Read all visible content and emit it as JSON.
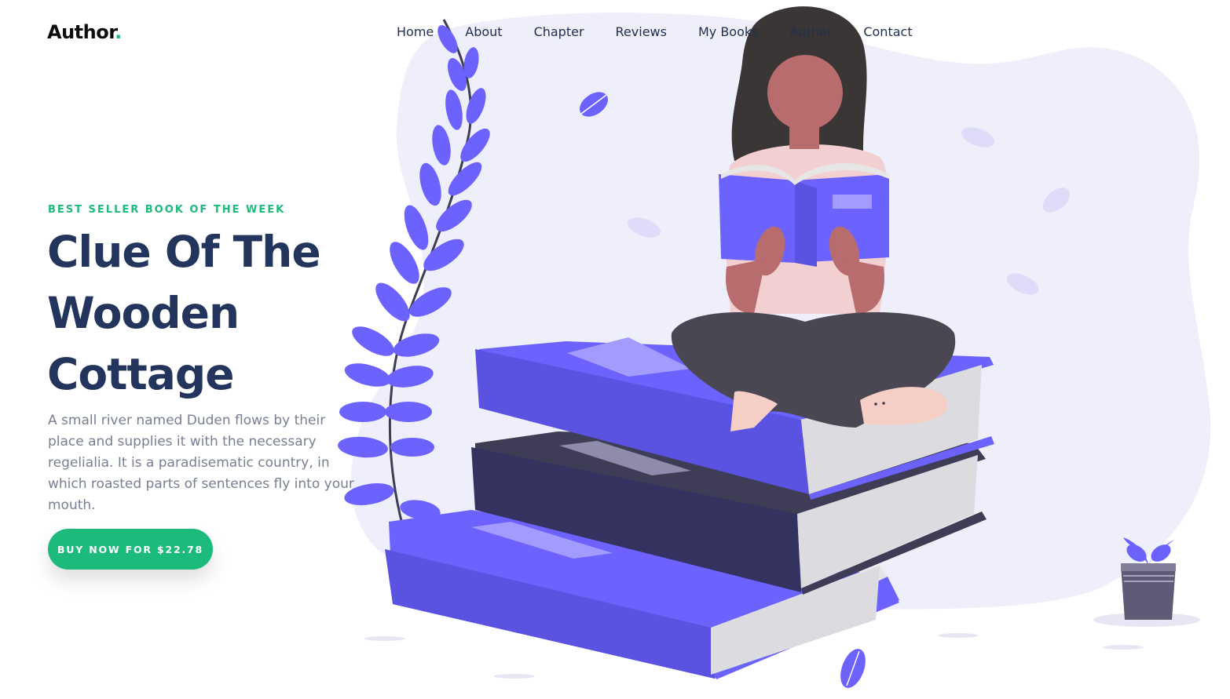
{
  "brand": {
    "name": "Author",
    "dot": "."
  },
  "nav": {
    "items": [
      {
        "label": "Home"
      },
      {
        "label": "About"
      },
      {
        "label": "Chapter"
      },
      {
        "label": "Reviews"
      },
      {
        "label": "My Books"
      },
      {
        "label": "Author"
      },
      {
        "label": "Contact"
      }
    ]
  },
  "hero": {
    "kicker": "BEST SELLER BOOK OF THE WEEK",
    "title": "Clue Of The Wooden Cottage",
    "description": "A small river named Duden flows by their place and supplies it with the necessary regelialia. It is a paradisematic country, in which roasted parts of sentences fly into your mouth.",
    "buy_label": "BUY NOW FOR $22.78"
  },
  "colors": {
    "accent": "#1cbb7b",
    "heading": "#23355c",
    "illustration_purple": "#6c63ff",
    "blob": "#efeffb"
  },
  "illustration": {
    "icons": [
      "woman-reading-illustration",
      "book-stack-illustration",
      "plant-branch-illustration",
      "leaf-icon",
      "plant-pot-illustration"
    ]
  }
}
